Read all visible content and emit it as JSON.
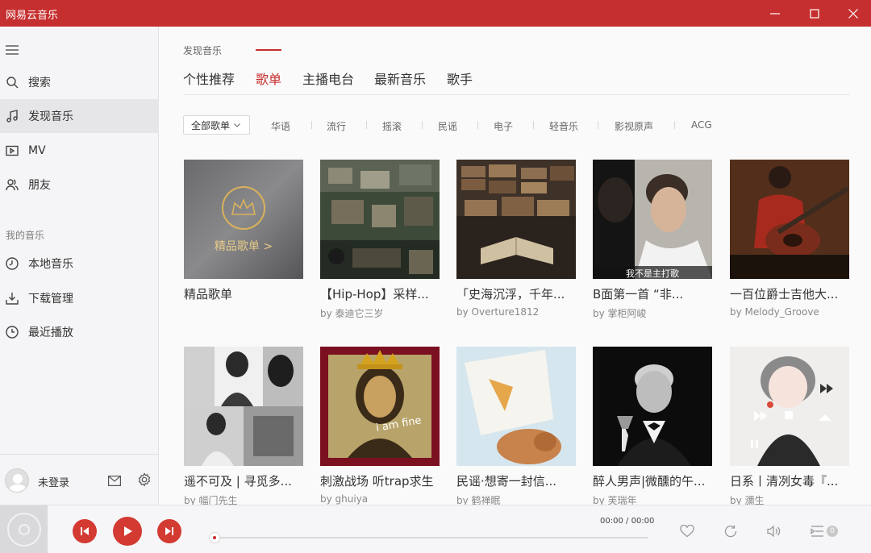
{
  "window": {
    "title": "网易云音乐",
    "accent": "#c62f2f"
  },
  "sidebar": {
    "items": [
      {
        "label": "搜索",
        "icon": "search-icon"
      },
      {
        "label": "发现音乐",
        "icon": "music-note-icon",
        "active": true
      },
      {
        "label": "MV",
        "icon": "video-icon"
      },
      {
        "label": "朋友",
        "icon": "friends-icon"
      }
    ],
    "section_title": "我的音乐",
    "my_music": [
      {
        "label": "本地音乐",
        "icon": "local-music-icon"
      },
      {
        "label": "下载管理",
        "icon": "download-icon"
      },
      {
        "label": "最近播放",
        "icon": "recent-icon"
      }
    ],
    "user": {
      "name": "未登录"
    }
  },
  "main": {
    "breadcrumb": "发现音乐",
    "tabs": [
      "个性推荐",
      "歌单",
      "主播电台",
      "最新音乐",
      "歌手"
    ],
    "active_tab": "歌单",
    "filter_label": "全部歌单",
    "genres": [
      "华语",
      "流行",
      "摇滚",
      "民谣",
      "电子",
      "轻音乐",
      "影视原声",
      "ACG"
    ],
    "premium_label": "精品歌单 >",
    "playlists": [
      {
        "title": "精品歌单",
        "creator": ""
      },
      {
        "title": "【Hip-Hop】采样...",
        "creator": "by 泰迪它三岁"
      },
      {
        "title": "「史海沉浮，千年...",
        "creator": "by Overture1812"
      },
      {
        "title": "B面第一首 “非...",
        "creator": "by 掌柜阿峻",
        "overlay": "我不是主打歌"
      },
      {
        "title": "一百位爵士吉他大...",
        "creator": "by Melody_Groove"
      },
      {
        "title": "遥不可及 | 寻觅多...",
        "creator": "by 幅门先生"
      },
      {
        "title": "刺激战场 听trap求生",
        "creator": "by ghuiya",
        "overlay": "i am fine"
      },
      {
        "title": "民谣·想寄一封信...",
        "creator": "by 鹤禅眠"
      },
      {
        "title": "醉人男声|微醺的午...",
        "creator": "by 芙瑞年"
      },
      {
        "title": "日系丨清冽女毒『...",
        "creator": "by 瀰生"
      }
    ]
  },
  "player": {
    "time_current": "00:00",
    "time_sep": "/",
    "time_total": "00:00",
    "queue_count": "0",
    "progress": 0
  }
}
